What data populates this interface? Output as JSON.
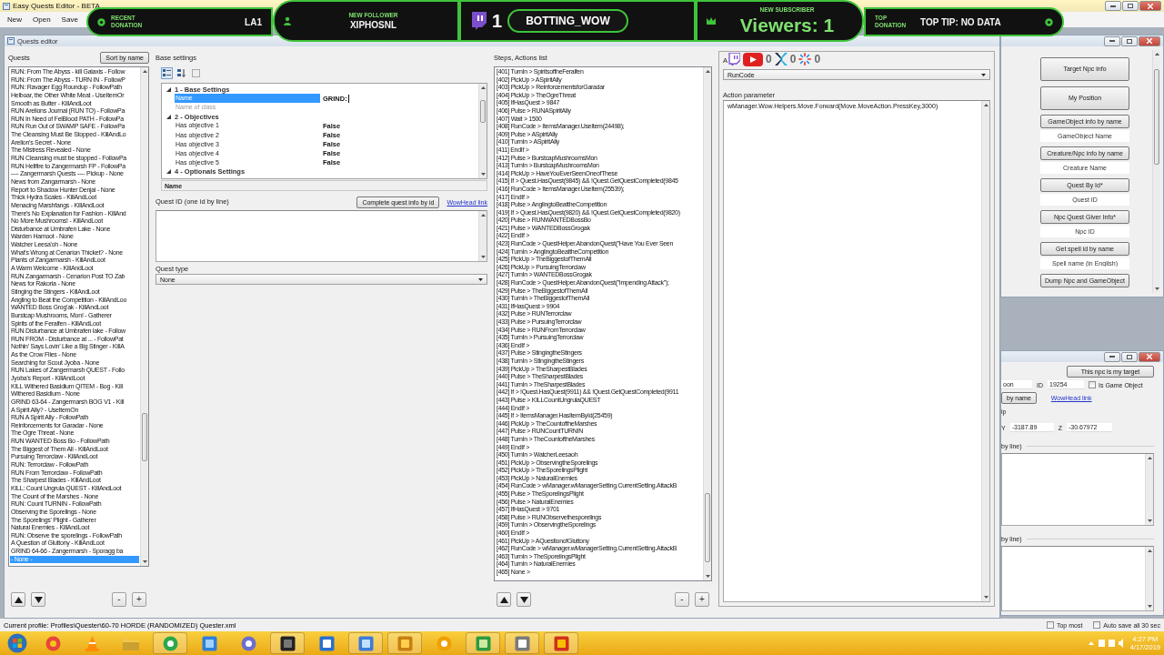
{
  "window": {
    "title": "Easy Quests Editor - BETA"
  },
  "menu": [
    "New",
    "Open",
    "Save"
  ],
  "stream_overlay": {
    "segments": [
      {
        "kind": "donation",
        "label": "RECENT DONATION",
        "value": "LA1"
      },
      {
        "kind": "follower",
        "label": "NEW FOLLOWER",
        "value": "XIPHOSNL"
      },
      {
        "kind": "channel",
        "count": "1",
        "value": "BOTTING_WOW"
      },
      {
        "kind": "subscriber",
        "label": "NEW SUBSCRIBER",
        "value": "Viewers: 1"
      },
      {
        "kind": "top_donation",
        "label": "TOP DONATION",
        "value": "TOP TIP: NO DATA"
      }
    ],
    "socials": [
      {
        "kind": "twitch"
      },
      {
        "kind": "youtube",
        "count": "0"
      },
      {
        "kind": "mixer",
        "count": "0"
      },
      {
        "kind": "sparkle",
        "count": "0"
      }
    ]
  },
  "editor": {
    "title": "Quests editor",
    "quests": {
      "label": "Quests",
      "sort_button": "Sort by name",
      "buttons": [
        "-",
        "+"
      ],
      "items": [
        {
          "label": "RUN: From The Abyss - kill Galaxis - Follow",
          "selected": false
        },
        {
          "label": "RUN: From The Abyss - TURN IN - FollowP",
          "selected": false
        },
        {
          "label": "RUN: Ravager Egg Roundup - FollowPath",
          "selected": false
        },
        {
          "label": "Helboar, the Other White Meat - UseItemOr",
          "selected": false
        },
        {
          "label": "Smooth as Butter - KillAndLoot",
          "selected": false
        },
        {
          "label": "RUN  Arelions Journal (RUN TO) - FollowPa",
          "selected": false
        },
        {
          "label": "RUN  In Need of FelBlood PATH - FollowPa",
          "selected": false
        },
        {
          "label": "RUN  Run Out of SWAMP SAFE - FollowPa",
          "selected": false
        },
        {
          "label": "The Cleansing Must Be Stopped - KillAndLo",
          "selected": false
        },
        {
          "label": "Arelion's Secret - None",
          "selected": false
        },
        {
          "label": "The Mistress Revealed - None",
          "selected": false
        },
        {
          "label": "RUN  Cleansing must be stopped - FollowPa",
          "selected": false
        },
        {
          "label": "RUN  Hellfire to Zangermarsh FP - FollowPa",
          "selected": false
        },
        {
          "label": "---- Zangermarsh Quests ---- Pickup - None",
          "selected": false
        },
        {
          "label": "News from Zangarmarsh - None",
          "selected": false
        },
        {
          "label": "Report to Shadow Hunter Denjai - None",
          "selected": false
        },
        {
          "label": "Thick Hydra Scales - KillAndLoot",
          "selected": false
        },
        {
          "label": "Menacing Marshfangs - KillAndLoot",
          "selected": false
        },
        {
          "label": "There's No Explanation for Fashion - KillAnd",
          "selected": false
        },
        {
          "label": "No More Mushrooms! - KillAndLoot",
          "selected": false
        },
        {
          "label": "Disturbance at Umbrafen Lake - None",
          "selected": false
        },
        {
          "label": "Warden Hamoot - None",
          "selected": false
        },
        {
          "label": "Watcher Leesa'oh - None",
          "selected": false
        },
        {
          "label": "What's Wrong at Cenarion Thicket? - None",
          "selected": false
        },
        {
          "label": "Plants of Zangarmarsh - KillAndLoot",
          "selected": false
        },
        {
          "label": "A Warm Welcome - KillAndLoot",
          "selected": false
        },
        {
          "label": "RUN  Zangarmarsh - Cenarion Post TO Zab",
          "selected": false
        },
        {
          "label": "News for Rakoria - None",
          "selected": false
        },
        {
          "label": "Stinging the Stingers - KillAndLoot",
          "selected": false
        },
        {
          "label": "Angling to Beat the Competition - KillAndLoo",
          "selected": false
        },
        {
          "label": "WANTED  Boss Grog'ak - KillAndLoot",
          "selected": false
        },
        {
          "label": "Burstcap Mushrooms, Mon! - Gatherer",
          "selected": false
        },
        {
          "label": "Spirits of the Feralfen - KillAndLoot",
          "selected": false
        },
        {
          "label": "RUN  Disturbance at Umbrafen lake - Follow",
          "selected": false
        },
        {
          "label": "RUN  FROM - Disturbance at ... - FollowPat",
          "selected": false
        },
        {
          "label": "Nothin' Says Lovin' Like a Big Stinger - KillA",
          "selected": false
        },
        {
          "label": "As the Crow Flies - None",
          "selected": false
        },
        {
          "label": "Searching for Scout Jyoba - None",
          "selected": false
        },
        {
          "label": "RUN  Lakes of Zangermarsh QUEST - Follo",
          "selected": false
        },
        {
          "label": "Jyoba's Report - KillAndLoot",
          "selected": false
        },
        {
          "label": "KILL  Withered Basidium QITEM - Bog - Kill",
          "selected": false
        },
        {
          "label": "Withered Basidium - None",
          "selected": false
        },
        {
          "label": "GRIND  63-64 - Zangermarsh BOG V1 - Kill",
          "selected": false
        },
        {
          "label": "A Spirit Ally? - UseItemOn",
          "selected": false
        },
        {
          "label": "RUN  A Spirit Ally - FollowPath",
          "selected": false
        },
        {
          "label": "Reinforcements for Garadar - None",
          "selected": false
        },
        {
          "label": "The Ogre Threat - None",
          "selected": false
        },
        {
          "label": "RUN  WANTED Boss Bo - FollowPath",
          "selected": false
        },
        {
          "label": "The Biggest of Them All - KillAndLoot",
          "selected": false
        },
        {
          "label": "Pursuing Terrorclaw - KillAndLoot",
          "selected": false
        },
        {
          "label": "RUN: Terrorclaw - FollowPath",
          "selected": false
        },
        {
          "label": "RUN  From Terrorclaw - FollowPath",
          "selected": false
        },
        {
          "label": "The Sharpest Blades - KillAndLoot",
          "selected": false
        },
        {
          "label": "KILL: Count Ungrula QUEST - KillAndLoot",
          "selected": false
        },
        {
          "label": "The Count of the Marshes - None",
          "selected": false
        },
        {
          "label": "RUN: Count TURNIN - FollowPath",
          "selected": false
        },
        {
          "label": "Observing the Sporelings - None",
          "selected": false
        },
        {
          "label": "The Sporelings' Plight - Gatherer",
          "selected": false
        },
        {
          "label": "Natural Enemies - KillAndLoot",
          "selected": false
        },
        {
          "label": "RUN: Observe the sporelings - FollowPath",
          "selected": false
        },
        {
          "label": "A Question of Gluttony - KillAndLoot",
          "selected": false
        },
        {
          "label": "GRIND  64-66 - Zangermarsh - Sporagg ba",
          "selected": false
        },
        {
          "label": "- None -",
          "selected": true
        }
      ]
    },
    "base_settings": {
      "label": "Base settings",
      "categories": [
        {
          "title": "1 - Base Settings",
          "expanded": true,
          "properties": [
            {
              "name": "Name",
              "value": "GRIND:",
              "selected": true,
              "disabled": false
            },
            {
              "name": "Name of class",
              "selected": false,
              "disabled": true
            }
          ]
        },
        {
          "title": "2 - Objectives",
          "expanded": true,
          "properties": [
            {
              "name": "Has objective 1",
              "value": "False",
              "selected": false,
              "disabled": false
            },
            {
              "name": "Has objective 2",
              "value": "False",
              "selected": false,
              "disabled": false
            },
            {
              "name": "Has objective 3",
              "value": "False",
              "selected": false,
              "disabled": false
            },
            {
              "name": "Has objective 4",
              "value": "False",
              "selected": false,
              "disabled": false
            },
            {
              "name": "Has objective 5",
              "value": "False",
              "selected": false,
              "disabled": false
            }
          ]
        },
        {
          "title": "4 - Optionals Settings",
          "expanded": true
        }
      ],
      "description": "Name",
      "quest_id_label": "Quest ID (one id by line)",
      "complete_button": "Complete quest info by id",
      "wowhead_link": "WowHead link",
      "quest_type_label": "Quest type",
      "quest_type": "None"
    },
    "steps": {
      "label": "Steps, Actions list",
      "buttons": [
        "-",
        "+"
      ],
      "items": [
        "[401] TurnIn > SpiritsoftheFeralfen",
        "[402] PickUp > ASpiritAlly",
        "[403] PickUp > ReinforcementsforGaradar",
        "[404] PickUp > TheOgreThreat",
        "[405] IfHasQuest > 9847",
        "[406] Pulse > RUNASpiritAlly",
        "[407] Wait > 1500",
        "[408] RunCode > ItemsManager.UseItem(24498);",
        "[409] Pulse > ASpiritAlly",
        "[410] TurnIn > ASpiritAlly",
        "[411] EndIf >",
        "[412] Pulse > BurstcapMushroomsMon",
        "[413] TurnIn > BurstcapMushroomsMon",
        "[414] PickUp > HaveYouEverSeenOneofThese",
        "[415] If > Quest.HasQuest(9845) && !Quest.GetQuestCompleted(9845",
        "[416] RunCode > ItemsManager.UseItem(25539);",
        "[417] EndIf >",
        "[418] Pulse > AnglingtoBeattheCompetition",
        "[419] If > Quest.HasQuest(9820) && !Quest.GetQuestCompleted(9820)",
        "[420] Pulse > RUNWANTEDBossBo",
        "[421] Pulse > WANTEDBossGrogak",
        "[422] EndIf >",
        "[423] RunCode > QuestHelper.AbandonQuest(\"Have You Ever Seen",
        "[424] TurnIn > AnglingtoBeattheCompetition",
        "[425] PickUp > TheBiggestofThemAll",
        "[426] PickUp > PursuingTerrorclaw",
        "[427] TurnIn > WANTEDBossGrogak",
        "[428] RunCode > QuestHelper.AbandonQuest(\"Impending Attack\");",
        "[429] Pulse > TheBiggestofThemAll",
        "[430] TurnIn > TheBiggestofThemAll",
        "[431] IfHasQuest > 9904",
        "[432] Pulse > RUNTerrorclaw",
        "[433] Pulse > PursuingTerrorclaw",
        "[434] Pulse > RUNFromTerrorclaw",
        "[435] TurnIn > PursuingTerrorclaw",
        "[436] EndIf >",
        "[437] Pulse > StingingtheStingers",
        "[438] TurnIn > StingingtheStingers",
        "[439] PickUp > TheSharpestBlades",
        "[440] Pulse > TheSharpestBlades",
        "[441] TurnIn > TheSharpestBlades",
        "[442] If > !Quest.HasQuest(9911) && !Quest.GetQuestCompleted(9911",
        "[443] Pulse > KILLCountUngrulaQUEST",
        "[444] EndIf >",
        "[445] If > ItemsManager.HasItemById(25459)",
        "[446] PickUp > TheCountoftheMarshes",
        "[447] Pulse > RUNCountTURNIN",
        "[448] TurnIn > TheCountoftheMarshes",
        "[449] EndIf >",
        "[450] TurnIn > WatcherLeesaoh",
        "[451] PickUp > ObservingtheSporelings",
        "[452] PickUp > TheSporelingsPlight",
        "[453] PickUp > NaturalEnemies",
        "[454] RunCode > wManager.wManagerSetting.CurrentSetting.AttackB",
        "[455] Pulse > TheSporelingsPlight",
        "[456] Pulse > NaturalEnemies",
        "[457] IfHasQuest > 9701",
        "[458] Pulse > RUNObservethesporelings",
        "[459] TurnIn > ObservingtheSporelings",
        "[460] EndIf >",
        "[461] PickUp > AQuestionofGluttony",
        "[462] RunCode > wManager.wManagerSetting.CurrentSetting.AttackB",
        "[463] TurnIn > TheSporelingsPlight",
        "[464] TurnIn > NaturalEnemies",
        "[465] None >"
      ]
    },
    "action": {
      "label": "A",
      "action_type": "RunCode",
      "parameter_label": "Action parameter",
      "parameter": "wManager.Wow.Helpers.Move.Forward(Move.MoveAction.PressKey,3000)"
    }
  },
  "tools": [
    {
      "kind": "large_button",
      "label": "Target Npc info"
    },
    {
      "kind": "large_button",
      "label": "My Position"
    },
    {
      "kind": "button",
      "label": "GameObject info by name"
    },
    {
      "kind": "field",
      "placeholder": "GameObject Name"
    },
    {
      "kind": "button",
      "label": "Creature/Npc info by name"
    },
    {
      "kind": "field",
      "placeholder": "Creature Name"
    },
    {
      "kind": "button",
      "label": "Quest By Id*"
    },
    {
      "kind": "field",
      "placeholder": "Quest ID"
    },
    {
      "kind": "button",
      "label": "Npc Quest Giver Info*"
    },
    {
      "kind": "field",
      "placeholder": "Npc ID"
    },
    {
      "kind": "button",
      "label": "Get spell id by name"
    },
    {
      "kind": "field",
      "placeholder": "Spell name (in English)"
    },
    {
      "kind": "button",
      "label": "Dump Npc and GameObject"
    }
  ],
  "npc_info": {
    "target_button": "This npc is my target",
    "name_value": "oon",
    "id_label": "ID",
    "id_value": "19254",
    "is_game_object": {
      "label": "Is Game Object",
      "checked": false
    },
    "search_button": "by name",
    "wowhead_link": "WowHead link",
    "position_label": "ip",
    "y_label": "Y",
    "y_value": "-3187.89",
    "z_label": "Z",
    "z_value": "-30.67972",
    "list_labels": [
      "by line)",
      "by line)"
    ]
  },
  "status_bar": {
    "profile": "Current profile: Profiles\\Quester\\60-70 HORDE (RANDOMIZED) Quester.xml",
    "options": [
      {
        "label": "Top most",
        "checked": false
      },
      {
        "label": "Auto save all 30 sec",
        "checked": false
      }
    ]
  },
  "taskbar": {
    "time": "4:27 PM",
    "date": "4/17/2019"
  }
}
